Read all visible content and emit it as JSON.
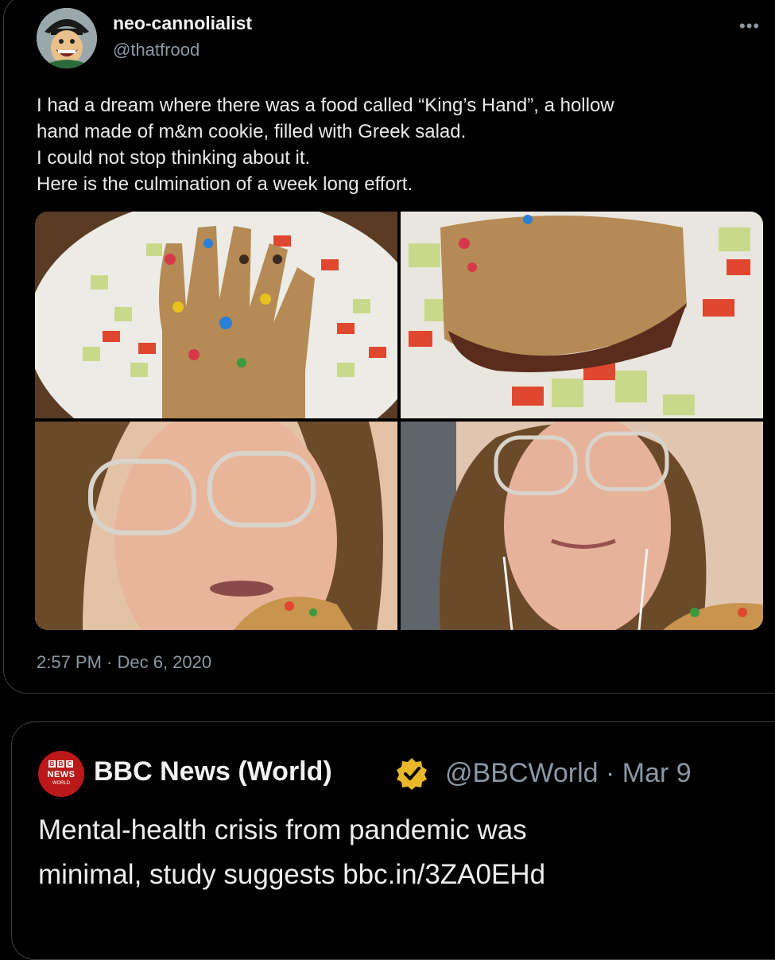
{
  "tweet": {
    "display_name": "neo-cannolialist",
    "handle": "@thatfrood",
    "more_icon": "more-horizontal-icon",
    "text_lines": [
      "I had a dream where there was a food called “King’s Hand”, a hollow",
      "hand made of m&m cookie, filled with Greek salad.",
      "I could not stop thinking about it.",
      "Here is the culmination of a week long effort."
    ],
    "media_images": [
      "photo-cookie-hand-on-plate",
      "photo-cookie-hand-cut-open",
      "photo-person-eating-cookie",
      "photo-person-smiling"
    ],
    "timestamp": "2:57 PM · Dec 6, 2020"
  },
  "quoted": {
    "logo_blocks": [
      "B",
      "B",
      "C"
    ],
    "logo_news": "NEWS",
    "logo_world": "WORLD",
    "display_name": "BBC News (World)",
    "verified_icon": "verified-badge-icon",
    "handle_date": "@BBCWorld · Mar 9",
    "text_lines": [
      "Mental-health crisis from pandemic was",
      "minimal, study suggests bbc.in/3ZA0EHd"
    ]
  },
  "colors": {
    "background": "#000000",
    "border": "#3a3d42",
    "muted": "#8b98a5",
    "bbc_red": "#bb1919",
    "verified_gold": "#e8b829"
  }
}
